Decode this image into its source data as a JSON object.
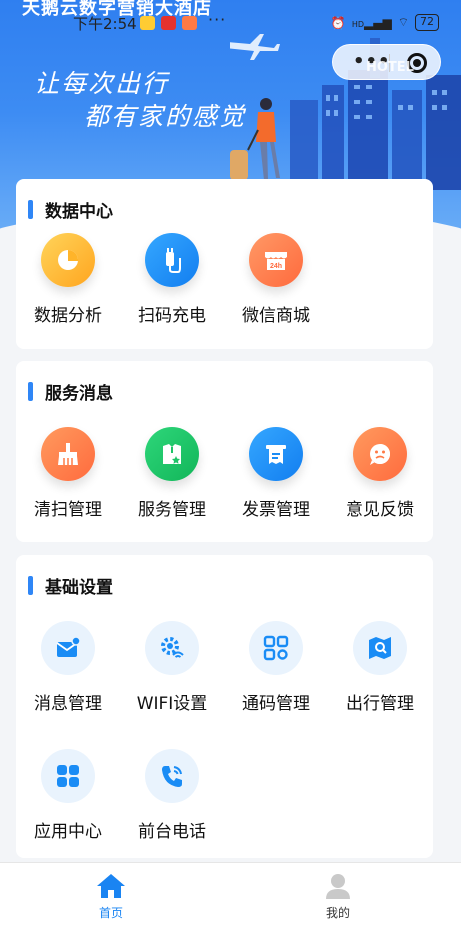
{
  "app_title": "天鹅云数字营销大酒店",
  "status_bar": {
    "time": "下午2:54",
    "more": "···",
    "battery": "72",
    "signal_label": "HD"
  },
  "capsule": {
    "dots": "•••"
  },
  "hero": {
    "slogan_line1": "让每次出行",
    "slogan_line2": "都有家的感觉",
    "hotel_sign": "HOTEL"
  },
  "sections": [
    {
      "title": "数据中心",
      "items": [
        {
          "label": "数据分析",
          "icon": "pie-chart-icon"
        },
        {
          "label": "扫码充电",
          "icon": "charging-plug-icon"
        },
        {
          "label": "微信商城",
          "icon": "store-24h-icon",
          "badge": "24h"
        }
      ]
    },
    {
      "title": "服务消息",
      "items": [
        {
          "label": "清扫管理",
          "icon": "broom-icon"
        },
        {
          "label": "服务管理",
          "icon": "service-star-icon"
        },
        {
          "label": "发票管理",
          "icon": "invoice-icon"
        },
        {
          "label": "意见反馈",
          "icon": "feedback-face-icon"
        }
      ]
    },
    {
      "title": "基础设置",
      "items": [
        {
          "label": "消息管理",
          "icon": "message-envelope-icon"
        },
        {
          "label": "WIFI设置",
          "icon": "wifi-gear-icon"
        },
        {
          "label": "通码管理",
          "icon": "qr-code-icon"
        },
        {
          "label": "出行管理",
          "icon": "map-search-icon"
        },
        {
          "label": "应用中心",
          "icon": "app-grid-icon"
        },
        {
          "label": "前台电话",
          "icon": "phone-icon"
        }
      ]
    }
  ],
  "tabbar": {
    "home": "首页",
    "mine": "我的"
  },
  "colors": {
    "accent": "#2f86f6",
    "hero_top": "#2f7ff0",
    "orange_grad": "#ff7a45",
    "yellow_grad": "#ffb52e",
    "green_grad": "#1fc467",
    "blue_grad": "#1a8cf5"
  }
}
